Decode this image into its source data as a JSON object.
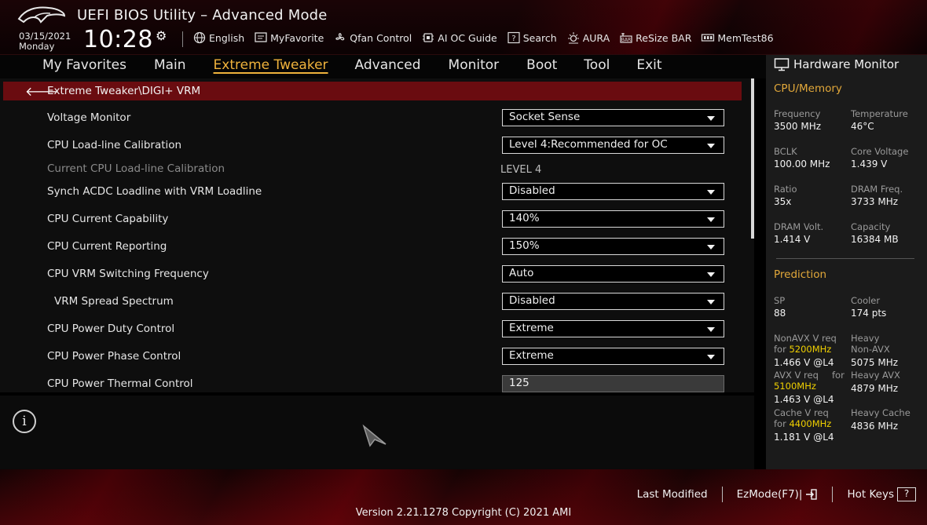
{
  "header": {
    "title": "UEFI BIOS Utility – Advanced Mode",
    "date": "03/15/2021",
    "weekday": "Monday",
    "time": "10:28",
    "toolbar": [
      {
        "label": "English",
        "icon": "globe-icon"
      },
      {
        "label": "MyFavorite",
        "icon": "favorite-icon"
      },
      {
        "label": "Qfan Control",
        "icon": "fan-icon"
      },
      {
        "label": "AI OC Guide",
        "icon": "chip-icon"
      },
      {
        "label": "Search",
        "icon": "search-icon"
      },
      {
        "label": "AURA",
        "icon": "aura-icon"
      },
      {
        "label": "ReSize BAR",
        "icon": "resize-bar-icon"
      },
      {
        "label": "MemTest86",
        "icon": "memtest-icon"
      }
    ]
  },
  "tabs": [
    {
      "label": "My Favorites"
    },
    {
      "label": "Main"
    },
    {
      "label": "Extreme Tweaker",
      "active": true
    },
    {
      "label": "Advanced"
    },
    {
      "label": "Monitor"
    },
    {
      "label": "Boot"
    },
    {
      "label": "Tool"
    },
    {
      "label": "Exit"
    }
  ],
  "breadcrumb": "Extreme Tweaker\\DIGI+ VRM",
  "settings": [
    {
      "label": "Voltage Monitor",
      "type": "dropdown",
      "value": "Socket Sense"
    },
    {
      "label": "CPU Load-line Calibration",
      "type": "dropdown",
      "value": "Level 4:Recommended for OC"
    },
    {
      "label": "Current CPU Load-line Calibration",
      "type": "text",
      "value": "LEVEL 4"
    },
    {
      "label": "Synch ACDC Loadline with VRM Loadline",
      "type": "dropdown",
      "value": "Disabled"
    },
    {
      "label": "CPU Current Capability",
      "type": "dropdown",
      "value": "140%"
    },
    {
      "label": "CPU Current Reporting",
      "type": "dropdown",
      "value": "150%"
    },
    {
      "label": "CPU VRM Switching Frequency",
      "type": "dropdown",
      "value": "Auto"
    },
    {
      "label": "VRM Spread Spectrum",
      "type": "dropdown",
      "value": "Disabled"
    },
    {
      "label": "CPU Power Duty Control",
      "type": "dropdown",
      "value": "Extreme"
    },
    {
      "label": "CPU Power Phase Control",
      "type": "dropdown",
      "value": "Extreme"
    },
    {
      "label": "CPU Power Thermal Control",
      "type": "input",
      "value": "125"
    }
  ],
  "hardware_monitor": {
    "title": "Hardware Monitor",
    "cpu_memory": {
      "heading": "CPU/Memory",
      "items": [
        {
          "label": "Frequency",
          "value": "3500 MHz"
        },
        {
          "label": "Temperature",
          "value": "46°C"
        },
        {
          "label": "BCLK",
          "value": "100.00 MHz"
        },
        {
          "label": "Core Voltage",
          "value": "1.439 V"
        },
        {
          "label": "Ratio",
          "value": "35x"
        },
        {
          "label": "DRAM Freq.",
          "value": "3733 MHz"
        },
        {
          "label": "DRAM Volt.",
          "value": "1.414 V"
        },
        {
          "label": "Capacity",
          "value": "16384 MB"
        }
      ]
    },
    "prediction": {
      "heading": "Prediction",
      "sp_label": "SP",
      "sp_value": "88",
      "cooler_label": "Cooler",
      "cooler_value": "174 pts",
      "nonavx_label": "NonAVX V req",
      "nonavx_for": "for",
      "nonavx_freq": "5200MHz",
      "nonavx_value": "1.466 V @L4",
      "heavy_nonavx_label1": "Heavy",
      "heavy_nonavx_label2": "Non-AVX",
      "heavy_nonavx_value": "5075 MHz",
      "avx_label": "AVX V req",
      "avx_for": "for",
      "avx_freq": "5100MHz",
      "avx_value": "1.463 V @L4",
      "heavy_avx_label": "Heavy AVX",
      "heavy_avx_value": "4879 MHz",
      "cache_label": "Cache V req",
      "cache_for": "for",
      "cache_freq": "4400MHz",
      "cache_value": "1.181 V @L4",
      "heavy_cache_label": "Heavy Cache",
      "heavy_cache_value": "4836 MHz"
    }
  },
  "footer": {
    "last_modified": "Last Modified",
    "ezmode": "EzMode(F7)|",
    "hotkeys": "Hot Keys",
    "hotkeys_key": "?",
    "version": "Version 2.21.1278 Copyright (C) 2021 AMI"
  },
  "colors": {
    "accent": "#f0b33c",
    "breadcrumb_bg": "#6a0c10",
    "highlight": "#f0d000",
    "section_heading": "#e2a83a"
  }
}
